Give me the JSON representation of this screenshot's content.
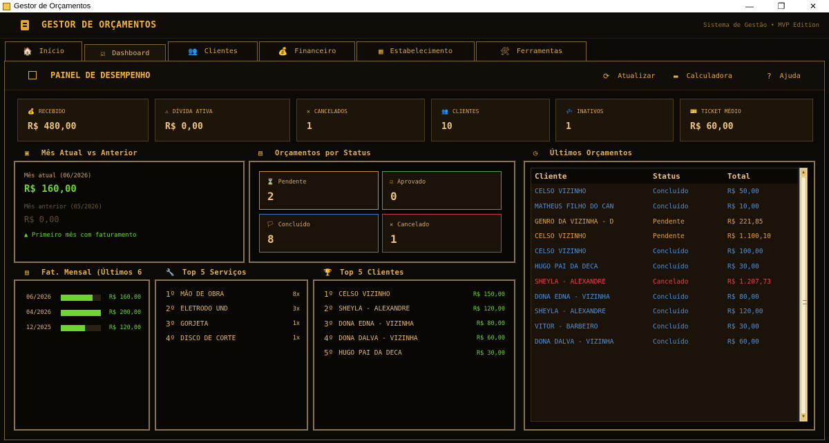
{
  "window": {
    "title": "Gestor de Orçamentos",
    "min": "—",
    "max": "❐",
    "close": "✕"
  },
  "header": {
    "title": "GESTOR DE ORÇAMENTOS",
    "subtitle": "Sistema de Gestão  •  MVP Edition"
  },
  "tabs": [
    {
      "label": "Início",
      "icon": "🏠"
    },
    {
      "label": "Dashboard",
      "icon": "☑"
    },
    {
      "label": "Clientes",
      "icon": "👥"
    },
    {
      "label": "Financeiro",
      "icon": "💰"
    },
    {
      "label": "Estabelecimento",
      "icon": "▦"
    },
    {
      "label": "Ferramentas",
      "icon": "🛠"
    }
  ],
  "panel": {
    "title": "PAINEL DE DESEMPENHO",
    "refresh": "Atualizar",
    "calculator": "Calculadora",
    "help": "Ajuda"
  },
  "kpis": [
    {
      "label": "RECEBIDO",
      "icon": "💰",
      "value": "R$ 480,00"
    },
    {
      "label": "DÍVIDA ATIVA",
      "icon": "⚠",
      "value": "R$ 0,00"
    },
    {
      "label": "CANCELADOS",
      "icon": "✕",
      "value": "1"
    },
    {
      "label": "CLIENTES",
      "icon": "👥",
      "value": "10"
    },
    {
      "label": "INATIVOS",
      "icon": "💤",
      "value": "1"
    },
    {
      "label": "TICKET MÉDIO",
      "icon": "🎫",
      "value": "R$ 60,00"
    }
  ],
  "month_compare": {
    "title": "Mês Atual vs Anterior",
    "current_label": "Mês atual (06/2026)",
    "current_value": "R$ 160,00",
    "previous_label": "Mês anterior (05/2026)",
    "previous_value": "R$ 0,00",
    "note": "▲ Primeiro mês com faturamento"
  },
  "status": {
    "title": "Orçamentos por Status",
    "cards": [
      {
        "label": "Pendente",
        "icon": "⏳",
        "value": "2",
        "color": "#c98a2a"
      },
      {
        "label": "Aprovado",
        "icon": "☑",
        "value": "0",
        "color": "#4ea34a"
      },
      {
        "label": "Concluído",
        "icon": "🏳",
        "value": "8",
        "color": "#3f78c8"
      },
      {
        "label": "Cancelado",
        "icon": "✕",
        "value": "1",
        "color": "#c8383a"
      }
    ]
  },
  "monthly": {
    "title": "Fat. Mensal (Últimos 6",
    "rows": [
      {
        "date": "06/2026",
        "value": "R$ 160,00",
        "fill": 0.8
      },
      {
        "date": "04/2026",
        "value": "R$ 200,00",
        "fill": 1.0
      },
      {
        "date": "12/2025",
        "value": "R$ 120,00",
        "fill": 0.6
      }
    ]
  },
  "top_services": {
    "title": "Top 5 Serviços",
    "rows": [
      {
        "rank": "1º",
        "name": "MÃO DE OBRA",
        "count": "8x"
      },
      {
        "rank": "2º",
        "name": "ELETRODO UND",
        "count": "3x"
      },
      {
        "rank": "3º",
        "name": "GORJETA",
        "count": "1x"
      },
      {
        "rank": "4º",
        "name": "DISCO DE CORTE",
        "count": "1x"
      }
    ]
  },
  "top_clients": {
    "title": "Top 5 Clientes",
    "rows": [
      {
        "rank": "1º",
        "name": "CELSO VIZINHO",
        "amount": "R$ 150,00"
      },
      {
        "rank": "2º",
        "name": "SHEYLA - ALEXANDRE",
        "amount": "R$ 120,00"
      },
      {
        "rank": "3º",
        "name": "DONA EDNA - VIZINHA",
        "amount": "R$ 80,00"
      },
      {
        "rank": "4º",
        "name": "DONA DALVA - VIZINHA",
        "amount": "R$ 60,00"
      },
      {
        "rank": "5º",
        "name": "HUGO PAI DA DECA",
        "amount": "R$ 30,00"
      }
    ]
  },
  "recent": {
    "title": "Últimos Orçamentos",
    "columns": [
      "Cliente",
      "Status",
      "Total"
    ],
    "rows": [
      {
        "client": "CELSO VIZINHO",
        "status": "Concluído",
        "total": "R$ 50,00",
        "kind": "done"
      },
      {
        "client": "MATHEUS FILHO DO CÂN",
        "status": "Concluído",
        "total": "R$ 10,00",
        "kind": "done"
      },
      {
        "client": "GENRO DA VIZINHA - D",
        "status": "Pendente",
        "total": "R$ 221,85",
        "kind": "pending"
      },
      {
        "client": "CELSO VIZINHO",
        "status": "Pendente",
        "total": "R$ 1.100,10",
        "kind": "pending"
      },
      {
        "client": "CELSO VIZINHO",
        "status": "Concluído",
        "total": "R$ 100,00",
        "kind": "done"
      },
      {
        "client": "HUGO PAI DA DECA",
        "status": "Concluído",
        "total": "R$ 30,00",
        "kind": "done"
      },
      {
        "client": "SHEYLA - ALEXANDRE",
        "status": "Cancelado",
        "total": "R$ 1.207,73",
        "kind": "cancel"
      },
      {
        "client": "DONA EDNA - VIZINHA",
        "status": "Concluído",
        "total": "R$ 80,00",
        "kind": "done"
      },
      {
        "client": "SHEYLA - ALEXANDRE",
        "status": "Concluído",
        "total": "R$ 120,00",
        "kind": "done"
      },
      {
        "client": "VITOR - BARBEIRO",
        "status": "Concluído",
        "total": "R$ 30,00",
        "kind": "done"
      },
      {
        "client": "DONA DALVA - VIZINHA",
        "status": "Concluído",
        "total": "R$ 60,00",
        "kind": "done"
      }
    ]
  },
  "colors": {
    "done": "#4f8fd8",
    "pending": "#e0a13a",
    "cancel": "#e0434a",
    "green": "#6dd52d",
    "accent": "#f0b43a"
  }
}
